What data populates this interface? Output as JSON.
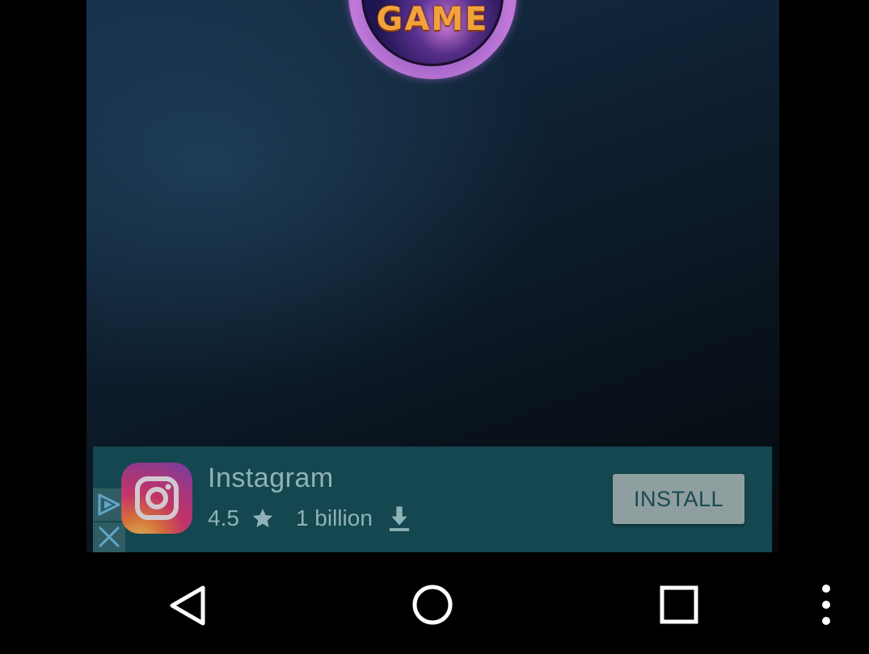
{
  "game": {
    "logo_text": "GAME"
  },
  "ad": {
    "app_name": "Instagram",
    "rating": "4.5",
    "downloads": "1 billion",
    "install_label": "INSTALL",
    "icons": {
      "app": "instagram-icon",
      "rating": "star-icon",
      "downloads": "download-icon",
      "ad_choices": "ad-choices-icon",
      "close": "close-icon"
    },
    "colors": {
      "banner_bg": "#14474f",
      "text": "#8fb3b8",
      "install_bg": "#8f9e9f"
    }
  },
  "navigation": {
    "back": "back-icon",
    "home": "home-icon",
    "recents": "recents-icon",
    "menu": "more-vert-icon"
  }
}
